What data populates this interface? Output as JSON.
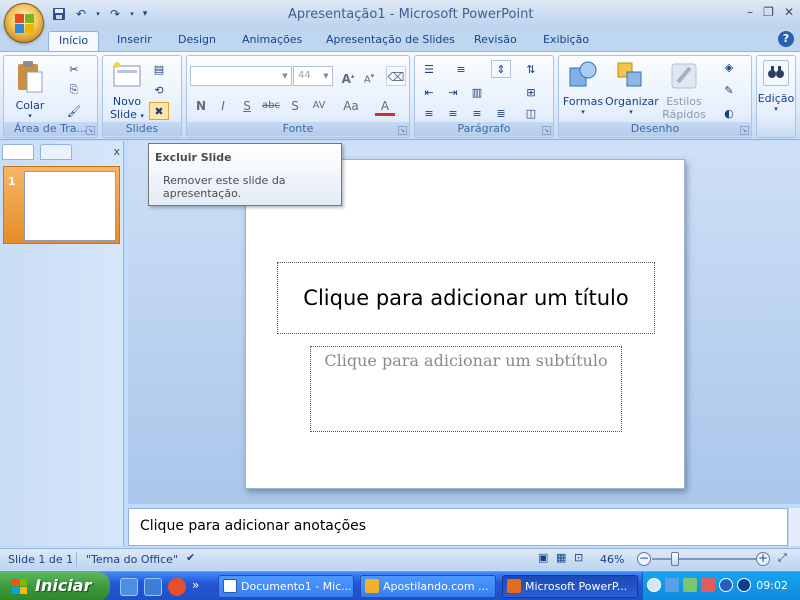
{
  "window": {
    "title": "Apresentação1 - Microsoft PowerPoint"
  },
  "ribbon_tabs": [
    {
      "label": "Início"
    },
    {
      "label": "Inserir"
    },
    {
      "label": "Design"
    },
    {
      "label": "Animações"
    },
    {
      "label": "Apresentação de Slides"
    },
    {
      "label": "Revisão"
    },
    {
      "label": "Exibição"
    }
  ],
  "groups": {
    "clipboard": {
      "label": "Área de Tra...",
      "paste_label": "Colar"
    },
    "slides": {
      "label": "Slides",
      "new_slide_label_1": "Novo",
      "new_slide_label_2": "Slide"
    },
    "font": {
      "label": "Fonte",
      "font_name": "",
      "font_size": "44"
    },
    "paragraph": {
      "label": "Parágrafo"
    },
    "drawing": {
      "label": "Desenho",
      "shapes_label": "Formas",
      "arrange_label": "Organizar",
      "quickstyles_label_1": "Estilos",
      "quickstyles_label_2": "Rápidos"
    },
    "editing": {
      "label": "Edição"
    }
  },
  "tooltip": {
    "title": "Excluir Slide",
    "body": "Remover este slide da apresentação."
  },
  "thumbnails": [
    {
      "number": "1"
    }
  ],
  "slide": {
    "title_placeholder": "Clique para adicionar um título",
    "subtitle_placeholder": "Clique para adicionar um subtítulo"
  },
  "notes": {
    "placeholder": "Clique para adicionar anotações"
  },
  "status": {
    "slide_info": "Slide 1 de 1",
    "theme": "\"Tema do Office\"",
    "zoom": "46%"
  },
  "taskbar": {
    "start_label": "Iniciar",
    "tasks": [
      {
        "label": "Documento1 - Mic..."
      },
      {
        "label": "Apostilando.com ..."
      },
      {
        "label": "Microsoft PowerP..."
      }
    ],
    "clock": "09:02"
  },
  "colors": {
    "ribbon_accent": "#15428b",
    "thumbnail_selected": "#e78c28",
    "taskbar_blue": "#2457d6",
    "start_green": "#3c9a3c"
  }
}
